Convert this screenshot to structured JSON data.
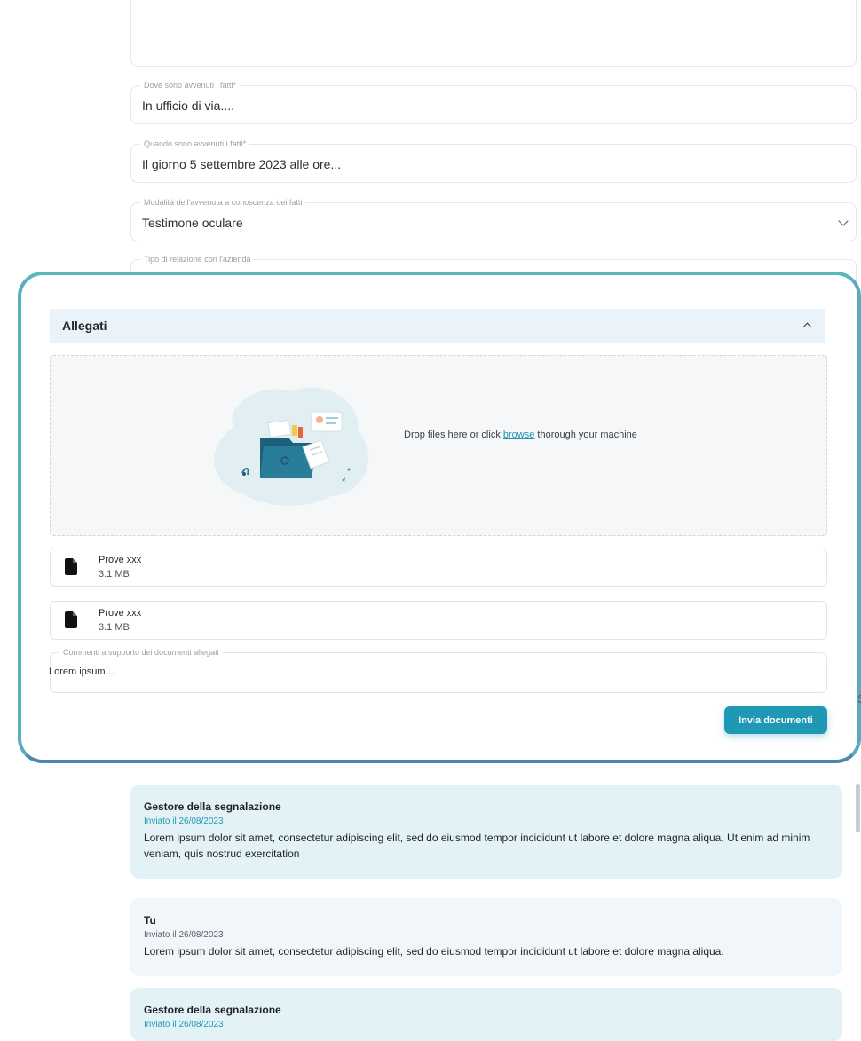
{
  "form": {
    "fields": [
      {
        "label": "Dove sono avvenuti i fatti*",
        "value": "In ufficio di via...."
      },
      {
        "label": "Quando sono avvenuti i fatti*",
        "value": "Il giorno 5 settembre 2023 alle ore..."
      },
      {
        "label": "Modalità dell'avvenuta a conoscenza dei fatti",
        "value": "Testimone oculare"
      },
      {
        "label": "Tipo di relazione con l'azienda",
        "value": ""
      }
    ]
  },
  "attachments": {
    "title": "Allegati",
    "drop_text_before": "Drop files here or click ",
    "drop_link": "browse",
    "drop_text_after": " thorough your machine",
    "files": [
      {
        "name": "Prove xxx",
        "size": "3.1 MB"
      },
      {
        "name": "Prove xxx",
        "size": "3.1 MB"
      }
    ],
    "comment": {
      "label": "Commenti a supporto dei documenti allegati",
      "value": "Lorem ipsum...."
    },
    "send_label": "Invia documenti"
  },
  "messages": [
    {
      "author": "Gestore della segnalazione",
      "date": "Inviato il 26/08/2023",
      "text": "Lorem ipsum dolor sit amet, consectetur adipiscing elit, sed do eiusmod tempor incididunt ut labore et dolore magna aliqua. Ut enim ad minim veniam, quis nostrud exercitation"
    },
    {
      "author": "Tu",
      "date": "Inviato il 26/08/2023",
      "text": "Lorem ipsum dolor sit amet, consectetur adipiscing elit, sed do eiusmod tempor incididunt ut labore et dolore magna aliqua."
    },
    {
      "author": "Gestore della segnalazione",
      "date": "Inviato il 26/08/2023",
      "text": ""
    }
  ],
  "edge_glyph": "S",
  "colors": {
    "accent": "#1f98b6",
    "card_border": "#4da6b5",
    "manager_bg": "#e2f2f6",
    "user_bg": "#f1f6fa"
  }
}
